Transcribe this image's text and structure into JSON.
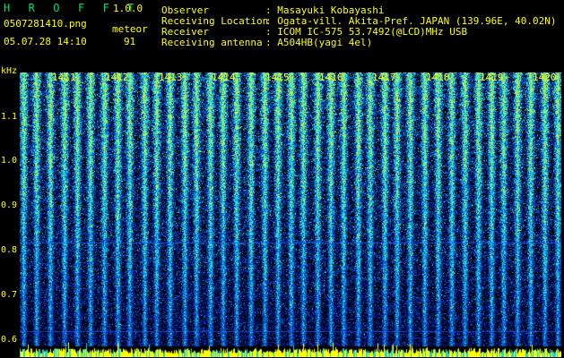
{
  "app": {
    "title": "H R O F F T",
    "version": "1.0.0",
    "filename": "0507281410.png",
    "datetime": "05.07.28 14:10",
    "mode_label": "meteor",
    "count": "91"
  },
  "info": [
    {
      "label": "Observer",
      "value": ": Masayuki Kobayashi"
    },
    {
      "label": "Receiving Location",
      "value": ": Ogata-vill. Akita-Pref. JAPAN (139.96E, 40.02N)"
    },
    {
      "label": "Receiver",
      "value": ": ICOM IC-575 53.7492(@LCD)MHz USB"
    },
    {
      "label": "Receiving antenna",
      "value": ": A504HB(yagi 4el)"
    }
  ],
  "spectrogram": {
    "y_unit": "kHz",
    "y_ticks": [
      "1.1",
      "1.0",
      "0.9",
      "0.8",
      "0.7",
      "0.6"
    ],
    "minute_labels": [
      "1411",
      "1412",
      "1413",
      "1414",
      "1415",
      "1416",
      "1417",
      "1418",
      "1419",
      "1420"
    ],
    "colors": {
      "bg": "#000000",
      "noise": "#0a2aa0",
      "signal": "#19d2dc",
      "hot": "#b4f050",
      "baseline": "#ffff00",
      "grid": "#2060ff"
    }
  }
}
